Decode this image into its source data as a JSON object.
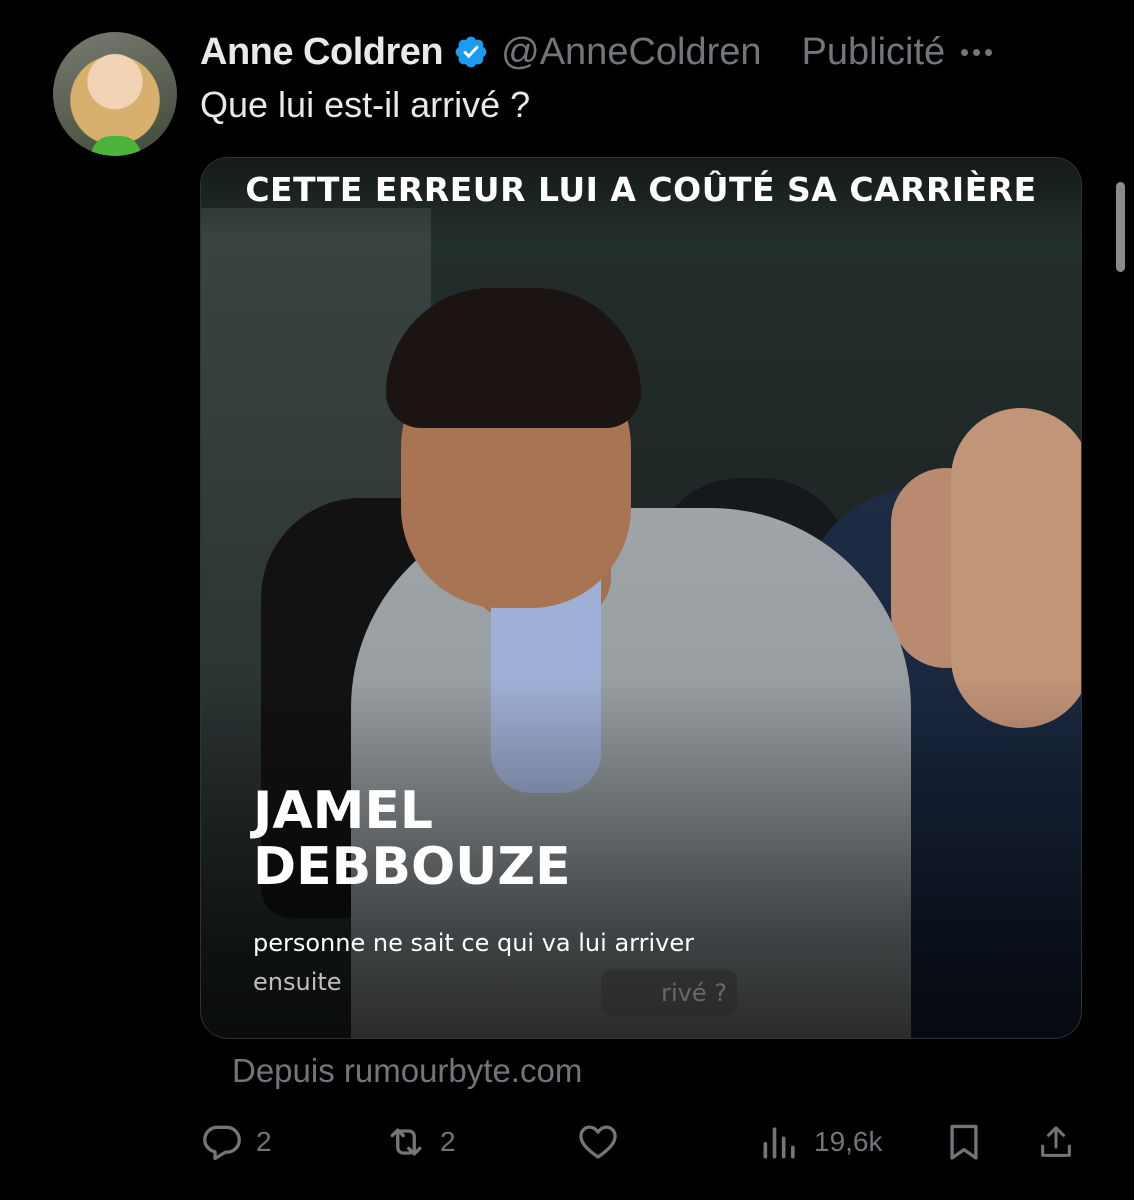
{
  "tweet": {
    "author_name": "Anne Coldren",
    "handle": "@AnneColdren",
    "ad_label": "Publicité",
    "text": "Que lui est-il arrivé ?",
    "verified": true
  },
  "card": {
    "headline": "CETTE ERREUR LUI A COÛTÉ SA CARRIÈRE",
    "name_line1": "JAMEL",
    "name_line2": "DEBBOUZE",
    "subtitle_line1": "personne ne sait ce qui va lui arriver",
    "subtitle_line2": "ensuite",
    "ghost_caption": "rivé ?"
  },
  "source": "Depuis rumourbyte.com",
  "actions": {
    "replies": "2",
    "reposts": "2",
    "views": "19,6k"
  },
  "icons": {
    "reply": "reply-icon",
    "repost": "repost-icon",
    "like": "heart-icon",
    "views": "views-icon",
    "bookmark": "bookmark-icon",
    "share": "share-icon",
    "more": "more-icon",
    "verified": "verified-badge-icon"
  },
  "colors": {
    "background": "#000000",
    "text_primary": "#e7e9ea",
    "text_secondary": "#71767b",
    "verified_blue": "#1d9bf0"
  }
}
